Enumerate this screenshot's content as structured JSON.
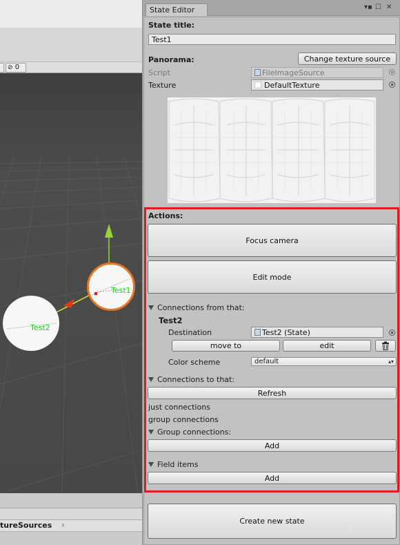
{
  "scene": {
    "viewport_menu_value": "0",
    "spheres": [
      {
        "label": "Test1",
        "selected": true
      },
      {
        "label": "Test2",
        "selected": false
      }
    ],
    "project_path_label": "tureSources"
  },
  "editor": {
    "tab_title": "State Editor",
    "state_title_label": "State title:",
    "state_title_value": "Test1",
    "panorama_label": "Panorama:",
    "change_texture_button": "Change texture source",
    "script_label": "Script",
    "script_value": "FileImageSource",
    "texture_label": "Texture",
    "texture_value": "DefaultTexture",
    "actions_label": "Actions:",
    "focus_camera_button": "Focus camera",
    "edit_mode_button": "Edit mode",
    "connections_from_label": "Connections from that:",
    "connection_name": "Test2",
    "destination_label": "Destination",
    "destination_value": "Test2 (State)",
    "move_to_button": "move to",
    "edit_button": "edit",
    "color_scheme_label": "Color scheme",
    "color_scheme_value": "default",
    "connections_to_label": "Connections to that:",
    "refresh_button": "Refresh",
    "just_connections_label": "just connections",
    "group_connections_label": "group connections",
    "group_connections_foldout": "Group connections:",
    "add_group_button": "Add",
    "field_items_label": "Field items",
    "add_field_button": "Add",
    "create_new_state_button": "Create new state"
  },
  "colors": {
    "highlight": "#e01b24",
    "selected_sphere_outline": "#e87722",
    "sphere_label": "#18d018",
    "gizmo_y_axis": "#9bd23a",
    "gizmo_x_axis": "#e8371a"
  }
}
